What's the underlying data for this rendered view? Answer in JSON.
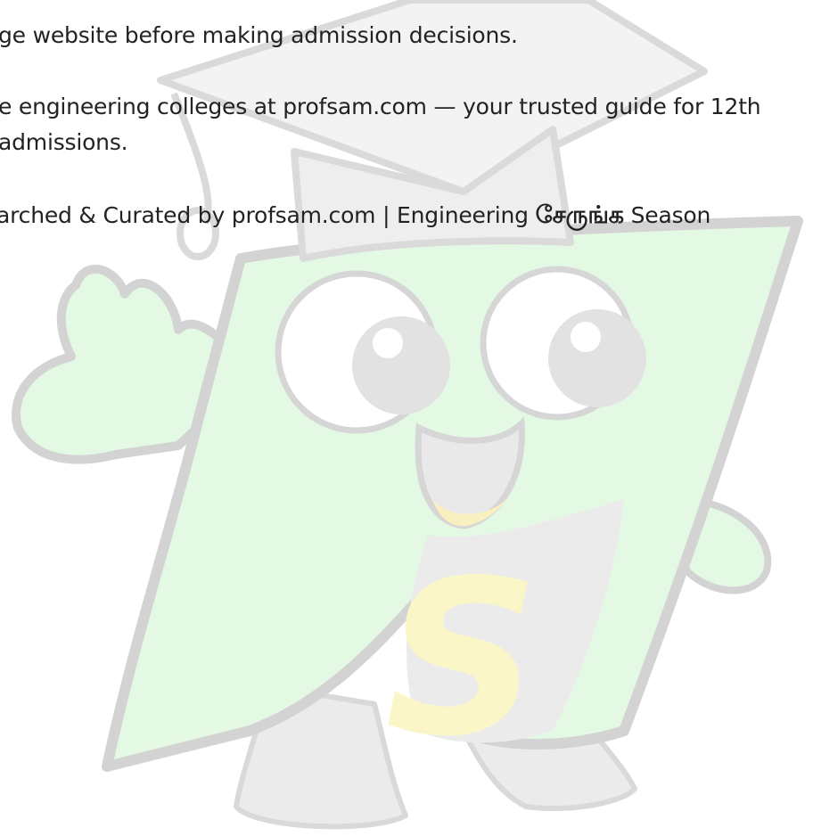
{
  "document": {
    "lines": [
      "ge website before making admission decisions.",
      "e engineering colleges at profsam.com — your trusted guide for 12th",
      "admissions."
    ],
    "footer": {
      "prefix": "arched & Curated by profsam.com | Engineering ",
      "tamil_word": "சேருங்க",
      "suffix": " Season"
    }
  },
  "watermark": {
    "logo_letter": "S",
    "colors": {
      "body": "#e4f9e4",
      "outline": "#d3d3d3",
      "cap": "#f3f3f3",
      "letter": "#fbf6c8",
      "mouth": "#faf0bf"
    }
  }
}
